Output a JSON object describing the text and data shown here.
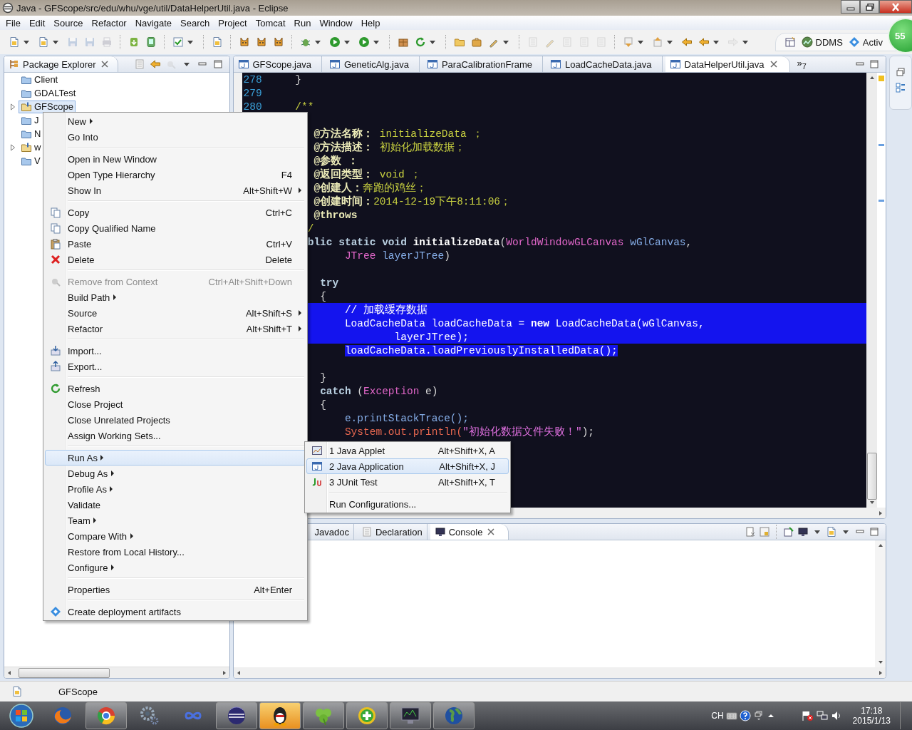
{
  "window": {
    "title": "Java - GFScope/src/edu/whu/vge/util/DataHelperUtil.java - Eclipse"
  },
  "menu_bar": [
    "File",
    "Edit",
    "Source",
    "Refactor",
    "Navigate",
    "Search",
    "Project",
    "Tomcat",
    "Run",
    "Window",
    "Help"
  ],
  "perspectives": [
    "DDMS",
    "Activ"
  ],
  "notification_badge": "55",
  "package_explorer": {
    "title": "Package Explorer",
    "items": [
      {
        "label": "Client",
        "kind": "folder",
        "selected": false,
        "expandable": false
      },
      {
        "label": "GDALTest",
        "kind": "folder",
        "selected": false,
        "expandable": false
      },
      {
        "label": "GFScope",
        "kind": "project",
        "selected": true,
        "expandable": true
      },
      {
        "label": "J",
        "kind": "folder",
        "selected": false,
        "expandable": false
      },
      {
        "label": "N",
        "kind": "folder",
        "selected": false,
        "expandable": false
      },
      {
        "label": "w",
        "kind": "project",
        "selected": false,
        "expandable": true
      },
      {
        "label": "V",
        "kind": "folder",
        "selected": false,
        "expandable": false
      }
    ]
  },
  "editor": {
    "tabs": [
      {
        "label": "GFScope.java",
        "selected": false
      },
      {
        "label": "GeneticAlg.java",
        "selected": false
      },
      {
        "label": "ParaCalibrationFrame",
        "selected": false
      },
      {
        "label": "LoadCacheData.java",
        "selected": false
      },
      {
        "label": "DataHelperUtil.java",
        "selected": true
      }
    ],
    "overflow": {
      "arrow": "»",
      "count": "7"
    },
    "lines": [
      {
        "kind": "code",
        "number": "278",
        "tokens": [
          {
            "t": "    }",
            "kind": "plain"
          }
        ]
      },
      {
        "kind": "blank",
        "number": "279"
      },
      {
        "kind": "code",
        "number": "280",
        "tokens": [
          {
            "t": "    /**",
            "kind": "doc"
          }
        ]
      },
      {
        "kind": "blank"
      },
      {
        "kind": "code",
        "tokens": [
          {
            "t": "       @方法名称：",
            "kind": "doctag"
          },
          {
            "t": " initializeData ；",
            "kind": "doc"
          }
        ]
      },
      {
        "kind": "code",
        "tokens": [
          {
            "t": "       @方法描述：",
            "kind": "doctag"
          },
          {
            "t": " 初始化加载数据；",
            "kind": "doc"
          }
        ]
      },
      {
        "kind": "code",
        "tokens": [
          {
            "t": "       @参数 ：",
            "kind": "doctag"
          }
        ]
      },
      {
        "kind": "code",
        "tokens": [
          {
            "t": "       @返回类型：",
            "kind": "doctag"
          },
          {
            "t": " void ；",
            "kind": "doc"
          }
        ]
      },
      {
        "kind": "code",
        "tokens": [
          {
            "t": "       @创建人：",
            "kind": "doctag"
          },
          {
            "t": "奔跑的鸡丝；",
            "kind": "doc"
          }
        ]
      },
      {
        "kind": "code",
        "tokens": [
          {
            "t": "       @创建时间：",
            "kind": "doctag"
          },
          {
            "t": "2014-12-19下午8:11:06；",
            "kind": "doc"
          }
        ]
      },
      {
        "kind": "code",
        "tokens": [
          {
            "t": "       @throws",
            "kind": "doctag"
          }
        ]
      },
      {
        "kind": "code",
        "tokens": [
          {
            "t": "      /",
            "kind": "doc"
          }
        ]
      },
      {
        "kind": "code",
        "tokens": [
          {
            "t": "      blic static void ",
            "kind": "kw"
          },
          {
            "t": "initializeData",
            "kind": "method"
          },
          {
            "t": "(",
            "kind": "plain"
          },
          {
            "t": "WorldWindowGLCanvas",
            "kind": "type"
          },
          {
            "t": " wGlCanvas",
            "kind": "param"
          },
          {
            "t": ",",
            "kind": "plain"
          }
        ]
      },
      {
        "kind": "code",
        "tokens": [
          {
            "t": "            JTree",
            "kind": "type"
          },
          {
            "t": " layerJTree",
            "kind": "param"
          },
          {
            "t": ")",
            "kind": "plain"
          }
        ]
      },
      {
        "kind": "blank"
      },
      {
        "kind": "code",
        "tokens": [
          {
            "t": "        try",
            "kind": "kw"
          }
        ]
      },
      {
        "kind": "code",
        "tokens": [
          {
            "t": "        {",
            "kind": "plain"
          }
        ]
      },
      {
        "kind": "selected",
        "tokens": [
          {
            "t": "            // 加载缓存数据",
            "kind": "plain"
          }
        ]
      },
      {
        "kind": "selected",
        "tokens": [
          {
            "t": "            LoadCacheData loadCacheData = ",
            "kind": "plain"
          },
          {
            "t": "new",
            "kind": "kw"
          },
          {
            "t": " LoadCacheData(wGlCanvas,",
            "kind": "plain"
          }
        ]
      },
      {
        "kind": "selected",
        "tokens": [
          {
            "t": "                    layerJTree);",
            "kind": "plain"
          }
        ]
      },
      {
        "kind": "selected-end",
        "tokens": [
          {
            "t": "            loadCacheData.loadPreviouslyInstalledData();",
            "kind": "plain"
          }
        ]
      },
      {
        "kind": "blank"
      },
      {
        "kind": "code",
        "tokens": [
          {
            "t": "        }",
            "kind": "plain"
          }
        ]
      },
      {
        "kind": "code",
        "tokens": [
          {
            "t": "        catch",
            "kind": "kw"
          },
          {
            "t": " (",
            "kind": "plain"
          },
          {
            "t": "Exception",
            "kind": "type"
          },
          {
            "t": " e)",
            "kind": "plain"
          }
        ]
      },
      {
        "kind": "code",
        "tokens": [
          {
            "t": "        {",
            "kind": "plain"
          }
        ]
      },
      {
        "kind": "code",
        "tokens": [
          {
            "t": "            e.printStackTrace();",
            "kind": "param"
          }
        ]
      },
      {
        "kind": "code",
        "tokens": [
          {
            "t": "            System.out.println(",
            "kind": "sys"
          },
          {
            "t": "\"初始化数据文件失败！\"",
            "kind": "string"
          },
          {
            "t": ");",
            "kind": "plain"
          }
        ]
      }
    ]
  },
  "context_menu": [
    [
      {
        "label": "New",
        "submenu": true,
        "selected": false,
        "disabled": false
      },
      {
        "label": "Go Into",
        "submenu": false,
        "selected": false,
        "disabled": false
      }
    ],
    [
      {
        "label": "Open in New Window",
        "submenu": false,
        "selected": false,
        "disabled": false
      },
      {
        "label": "Open Type Hierarchy",
        "shortcut": "F4",
        "submenu": false,
        "selected": false,
        "disabled": false
      },
      {
        "label": "Show In",
        "shortcut": "Alt+Shift+W",
        "submenu": true,
        "selected": false,
        "disabled": false
      }
    ],
    [
      {
        "label": "Copy",
        "shortcut": "Ctrl+C",
        "submenu": false,
        "selected": false,
        "disabled": false
      },
      {
        "label": "Copy Qualified Name",
        "submenu": false,
        "selected": false,
        "disabled": false
      },
      {
        "label": "Paste",
        "shortcut": "Ctrl+V",
        "submenu": false,
        "selected": false,
        "disabled": false
      },
      {
        "label": "Delete",
        "shortcut": "Delete",
        "submenu": false,
        "selected": false,
        "disabled": false
      }
    ],
    [
      {
        "label": "Remove from Context",
        "shortcut": "Ctrl+Alt+Shift+Down",
        "submenu": false,
        "selected": false,
        "disabled": true
      },
      {
        "label": "Build Path",
        "submenu": true,
        "selected": false,
        "disabled": false
      },
      {
        "label": "Source",
        "shortcut": "Alt+Shift+S",
        "submenu": true,
        "selected": false,
        "disabled": false
      },
      {
        "label": "Refactor",
        "shortcut": "Alt+Shift+T",
        "submenu": true,
        "selected": false,
        "disabled": false
      }
    ],
    [
      {
        "label": "Import...",
        "submenu": false,
        "selected": false,
        "disabled": false
      },
      {
        "label": "Export...",
        "submenu": false,
        "selected": false,
        "disabled": false
      }
    ],
    [
      {
        "label": "Refresh",
        "submenu": false,
        "selected": false,
        "disabled": false
      },
      {
        "label": "Close Project",
        "submenu": false,
        "selected": false,
        "disabled": false
      },
      {
        "label": "Close Unrelated Projects",
        "submenu": false,
        "selected": false,
        "disabled": false
      },
      {
        "label": "Assign Working Sets...",
        "submenu": false,
        "selected": false,
        "disabled": false
      }
    ],
    [
      {
        "label": "Run As",
        "submenu": true,
        "selected": true,
        "disabled": false
      },
      {
        "label": "Debug As",
        "submenu": true,
        "selected": false,
        "disabled": false
      },
      {
        "label": "Profile As",
        "submenu": true,
        "selected": false,
        "disabled": false
      },
      {
        "label": "Validate",
        "submenu": false,
        "selected": false,
        "disabled": false
      },
      {
        "label": "Team",
        "submenu": true,
        "selected": false,
        "disabled": false
      },
      {
        "label": "Compare With",
        "submenu": true,
        "selected": false,
        "disabled": false
      },
      {
        "label": "Restore from Local History...",
        "submenu": false,
        "selected": false,
        "disabled": false
      },
      {
        "label": "Configure",
        "submenu": true,
        "selected": false,
        "disabled": false
      }
    ],
    [
      {
        "label": "Properties",
        "shortcut": "Alt+Enter",
        "submenu": false,
        "selected": false,
        "disabled": false
      }
    ],
    [
      {
        "label": "Create deployment artifacts",
        "submenu": false,
        "selected": false,
        "disabled": false
      }
    ]
  ],
  "run_as_submenu": [
    [
      {
        "label": "1 Java Applet",
        "shortcut": "Alt+Shift+X, A",
        "selected": false
      },
      {
        "label": "2 Java Application",
        "shortcut": "Alt+Shift+X, J",
        "selected": true
      },
      {
        "label": "3 JUnit Test",
        "shortcut": "Alt+Shift+X, T",
        "selected": false
      }
    ],
    [
      {
        "label": "Run Configurations...",
        "selected": false
      }
    ]
  ],
  "bottom_panel": {
    "tabs": [
      {
        "label": "Javadoc",
        "selected": false
      },
      {
        "label": "Declaration",
        "selected": false
      },
      {
        "label": "Console",
        "selected": true
      }
    ]
  },
  "status_bar": {
    "text": "GFScope"
  },
  "taskbar": {
    "apps": [
      {
        "selected": false
      },
      {
        "selected": true
      },
      {
        "selected": false
      },
      {
        "selected": false
      },
      {
        "selected": true
      },
      {
        "selected": true
      },
      {
        "selected": true
      },
      {
        "selected": true
      },
      {
        "selected": true
      },
      {
        "selected": true
      }
    ],
    "language": "CH",
    "time": "17:18",
    "date": "2015/1/13"
  }
}
